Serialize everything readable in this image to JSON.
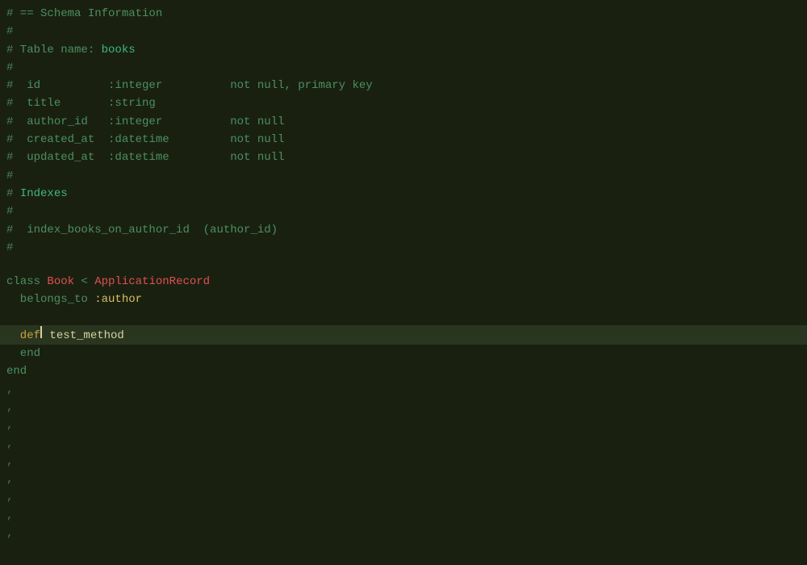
{
  "editor": {
    "background": "#1a2010",
    "lines": [
      {
        "id": 1,
        "content": [
          {
            "type": "comment-hash",
            "text": "#"
          },
          {
            "type": "comment-text",
            "text": " == Schema Information"
          }
        ]
      },
      {
        "id": 2,
        "content": [
          {
            "type": "comment-hash",
            "text": "#"
          }
        ]
      },
      {
        "id": 3,
        "content": [
          {
            "type": "comment-hash",
            "text": "#"
          },
          {
            "type": "comment-text",
            "text": " Table name: "
          },
          {
            "type": "comment-keyword",
            "text": "books"
          }
        ]
      },
      {
        "id": 4,
        "content": [
          {
            "type": "comment-hash",
            "text": "#"
          }
        ]
      },
      {
        "id": 5,
        "content": [
          {
            "type": "comment-hash",
            "text": "#"
          },
          {
            "type": "comment-text",
            "text": "  id          :integer          not null, primary key"
          }
        ]
      },
      {
        "id": 6,
        "content": [
          {
            "type": "comment-hash",
            "text": "#"
          },
          {
            "type": "comment-text",
            "text": "  title       :string"
          }
        ]
      },
      {
        "id": 7,
        "content": [
          {
            "type": "comment-hash",
            "text": "#"
          },
          {
            "type": "comment-text",
            "text": "  author_id   :integer          not null"
          }
        ]
      },
      {
        "id": 8,
        "content": [
          {
            "type": "comment-hash",
            "text": "#"
          },
          {
            "type": "comment-text",
            "text": "  created_at  :datetime         not null"
          }
        ]
      },
      {
        "id": 9,
        "content": [
          {
            "type": "comment-hash",
            "text": "#"
          },
          {
            "type": "comment-text",
            "text": "  updated_at  :datetime         not null"
          }
        ]
      },
      {
        "id": 10,
        "content": [
          {
            "type": "comment-hash",
            "text": "#"
          }
        ]
      },
      {
        "id": 11,
        "content": [
          {
            "type": "comment-hash",
            "text": "#"
          },
          {
            "type": "comment-text",
            "text": " "
          },
          {
            "type": "comment-keyword",
            "text": "Indexes"
          }
        ]
      },
      {
        "id": 12,
        "content": [
          {
            "type": "comment-hash",
            "text": "#"
          }
        ]
      },
      {
        "id": 13,
        "content": [
          {
            "type": "comment-hash",
            "text": "#"
          },
          {
            "type": "comment-text",
            "text": "  index_books_on_author_id  (author_id)"
          }
        ]
      },
      {
        "id": 14,
        "content": [
          {
            "type": "comment-hash",
            "text": "#"
          }
        ]
      },
      {
        "id": 15,
        "content": []
      },
      {
        "id": 16,
        "content": [
          {
            "type": "kw-class",
            "text": "class "
          },
          {
            "type": "class-name",
            "text": "Book"
          },
          {
            "type": "plain",
            "text": " < "
          },
          {
            "type": "parent-class",
            "text": "ApplicationRecord"
          }
        ]
      },
      {
        "id": 17,
        "content": [
          {
            "type": "belongs-to-method",
            "text": "  belongs_to "
          },
          {
            "type": "symbol",
            "text": ":author"
          }
        ]
      },
      {
        "id": 18,
        "content": []
      },
      {
        "id": 19,
        "content": [
          {
            "type": "cursor-line",
            "text": ""
          }
        ],
        "cursor": true
      },
      {
        "id": 20,
        "content": [
          {
            "type": "kw-end",
            "text": "  end"
          }
        ]
      },
      {
        "id": 21,
        "content": [
          {
            "type": "kw-end",
            "text": "end"
          }
        ]
      },
      {
        "id": 22,
        "content": [
          {
            "type": "comma-line",
            "text": ","
          }
        ]
      },
      {
        "id": 23,
        "content": [
          {
            "type": "comma-line",
            "text": ","
          }
        ]
      },
      {
        "id": 24,
        "content": [
          {
            "type": "comma-line",
            "text": ","
          }
        ]
      },
      {
        "id": 25,
        "content": [
          {
            "type": "comma-line",
            "text": ","
          }
        ]
      },
      {
        "id": 26,
        "content": [
          {
            "type": "comma-line",
            "text": ","
          }
        ]
      },
      {
        "id": 27,
        "content": [
          {
            "type": "comma-line",
            "text": ","
          }
        ]
      },
      {
        "id": 28,
        "content": [
          {
            "type": "comma-line",
            "text": ","
          }
        ]
      },
      {
        "id": 29,
        "content": [
          {
            "type": "comma-line",
            "text": ","
          }
        ]
      },
      {
        "id": 30,
        "content": [
          {
            "type": "comma-line",
            "text": ","
          }
        ]
      }
    ]
  }
}
